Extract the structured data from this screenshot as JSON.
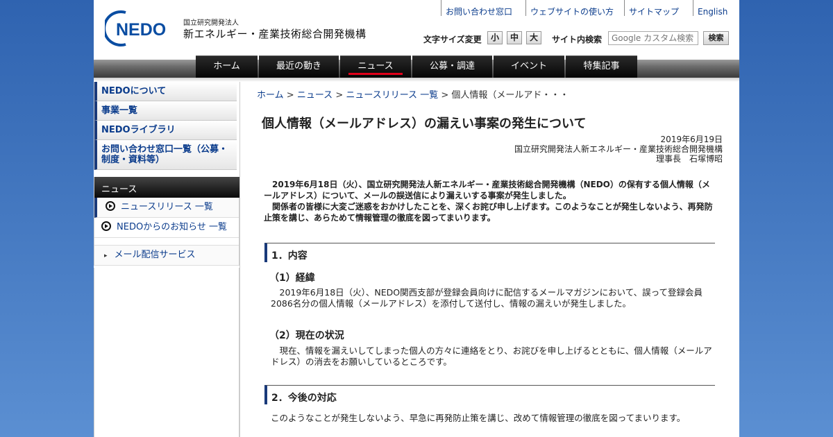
{
  "header": {
    "logo_text": "NEDO",
    "org_small": "国立研究開発法人",
    "org_large": "新エネルギー・産業技術総合開発機構",
    "top_links": [
      "お問い合わせ窓口",
      "ウェブサイトの使い方",
      "サイトマップ",
      "English"
    ],
    "font_size_label": "文字サイズ変更",
    "font_sizes": [
      "小",
      "中",
      "大"
    ],
    "search_label": "サイト内検索",
    "search_placeholder": "Google カスタム検索",
    "search_button": "検索"
  },
  "nav": {
    "items": [
      "ホーム",
      "最近の動き",
      "ニュース",
      "公募・調達",
      "イベント",
      "特集記事"
    ],
    "active_index": 2
  },
  "sidebar": {
    "main_items": [
      "NEDOについて",
      "事業一覧",
      "NEDOライブラリ",
      "お問い合わせ窓口一覧（公募・制度・資料等）"
    ],
    "section_title": "ニュース",
    "sub_items": [
      "ニュースリリース 一覧",
      "NEDOからのお知らせ 一覧"
    ],
    "mail_service": "メール配信サービス"
  },
  "breadcrumb": {
    "links": [
      "ホーム",
      "ニュース",
      "ニュースリリース 一覧"
    ],
    "separator": ">",
    "current": "個人情報（メールアド・・・"
  },
  "article": {
    "title": "個人情報（メールアドレス）の漏えい事案の発生について",
    "date": "2019年6月19日",
    "issuer": "国立研究開発法人新エネルギー・産業技術総合開発機構",
    "signer": "理事長　石塚博昭",
    "lead_1": "2019年6月18日（火）、国立研究開発法人新エネルギー・産業技術総合開発機構（NEDO）の保有する個人情報（メールアドレス）について、メールの誤送信により漏えいする事案が発生しました。",
    "lead_2": "関係者の皆様に大変ご迷惑をおかけしたことを、深くお詫び申し上げます。このようなことが発生しないよう、再発防止策を講じ、あらためて情報管理の徹底を図ってまいります。",
    "section1_title": "1．内容",
    "sub1_title": "（1）経緯",
    "sub1_text": "2019年6月18日（火）、NEDO関西支部が登録会員向けに配信するメールマガジンにおいて、誤って登録会員2086名分の個人情報（メールアドレス）を添付して送付し、情報の漏えいが発生しました。",
    "sub2_title": "（2）現在の状況",
    "sub2_text": "現在、情報を漏えいしてしまった個人の方々に連絡をとり、お詫びを申し上げるとともに、個人情報（メールアドレス）の消去をお願いしているところです。",
    "section2_title": "2．今後の対応",
    "section2_text": "このようなことが発生しないよう、早急に再発防止策を講じ、改めて情報管理の徹底を図ってまいります。"
  },
  "colors": {
    "background": "#3a6bb3",
    "link": "#0b3c8c",
    "accent_bar": "#1a3a7a",
    "nav_active_underline": "#e0001a",
    "logo_blue": "#0a4da2"
  }
}
